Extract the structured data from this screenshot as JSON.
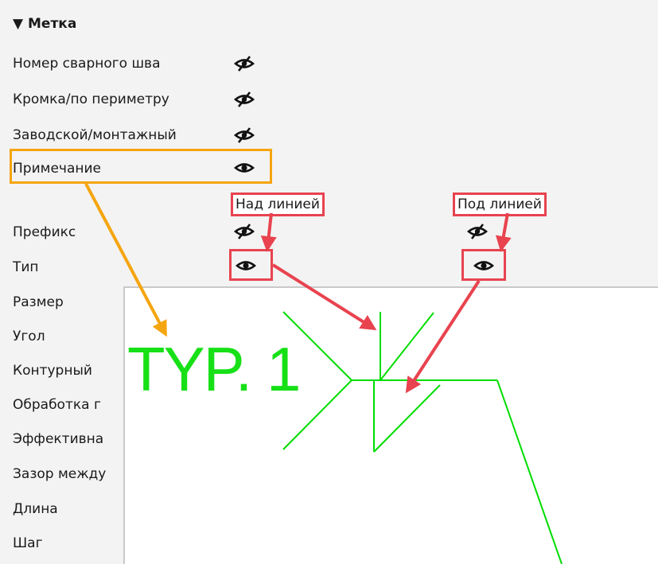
{
  "section": {
    "title": "▼ Метка"
  },
  "rows": [
    {
      "label": "Номер сварного шва",
      "visibility": "eye-slash"
    },
    {
      "label": "Кромка/по периметру",
      "visibility": "eye-slash"
    },
    {
      "label": "Заводской/монтажный",
      "visibility": "eye-slash"
    },
    {
      "label": "Примечание",
      "visibility": "eye"
    },
    {
      "label": "Префикс",
      "above_line": "eye-slash",
      "below_line": "eye-slash"
    },
    {
      "label": "Тип",
      "above_line": "eye",
      "below_line": "eye"
    },
    {
      "label": "Размер"
    },
    {
      "label": "Угол"
    },
    {
      "label": "Контурный"
    },
    {
      "label": "Обработка г"
    },
    {
      "label": "Эффективна"
    },
    {
      "label": "Зазор между"
    },
    {
      "label": "Длина"
    },
    {
      "label": "Шаг"
    }
  ],
  "columns": {
    "above": "Над линией",
    "below": "Под линией"
  },
  "preview": {
    "text": "TYP. 1",
    "line_color": "#00dd00"
  },
  "colors": {
    "highlight_orange": "#f5a50f",
    "highlight_red": "#e8434f"
  }
}
